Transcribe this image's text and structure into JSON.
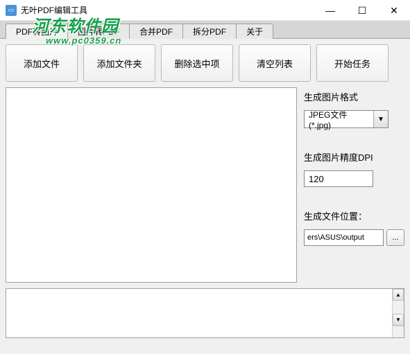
{
  "window": {
    "title": "无叶PDF编辑工具",
    "controls": {
      "min": "—",
      "max": "☐",
      "close": "✕"
    }
  },
  "watermark": {
    "main": "河东软件园",
    "sub": "www.pc0359.cn"
  },
  "tabs": [
    {
      "label": "PDF转图片",
      "active": true
    },
    {
      "label": "图片转PDF",
      "active": false
    },
    {
      "label": "合并PDF",
      "active": false
    },
    {
      "label": "拆分PDF",
      "active": false
    },
    {
      "label": "关于",
      "active": false
    }
  ],
  "toolbar": [
    {
      "label": "添加文件",
      "name": "add-file-button"
    },
    {
      "label": "添加文件夹",
      "name": "add-folder-button"
    },
    {
      "label": "删除选中项",
      "name": "delete-selected-button"
    },
    {
      "label": "清空列表",
      "name": "clear-list-button"
    },
    {
      "label": "开始任务",
      "name": "start-task-button"
    }
  ],
  "side": {
    "format_label": "生成图片格式",
    "format_value": "JPEG文件(*.jpg)",
    "dpi_label": "生成图片精度DPI",
    "dpi_value": "120",
    "path_label": "生成文件位置：",
    "path_value": "ers\\ASUS\\output",
    "browse": "..."
  }
}
